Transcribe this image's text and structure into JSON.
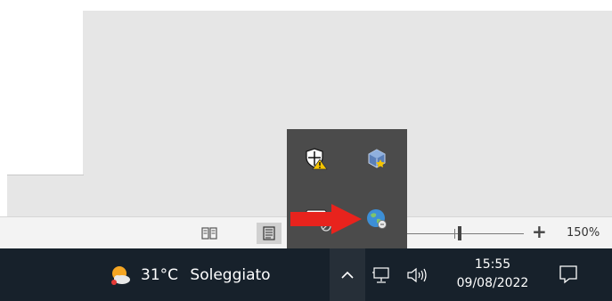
{
  "status_bar": {
    "zoom_minus": "−",
    "zoom_plus": "+",
    "zoom_level": "150%",
    "zoom_value": 150
  },
  "taskbar": {
    "weather_temp": "31°C",
    "weather_desc": "Soleggiato",
    "clock_time": "15:55",
    "clock_date": "09/08/2022"
  },
  "overflow_icons": [
    "security-warning-icon",
    "virtualbox-icon",
    "usb-eject-icon",
    "network-globe-icon"
  ],
  "colors": {
    "taskbar_bg": "#17212b",
    "overflow_bg": "#4b4b4b",
    "annotation_arrow": "#e8231d"
  }
}
